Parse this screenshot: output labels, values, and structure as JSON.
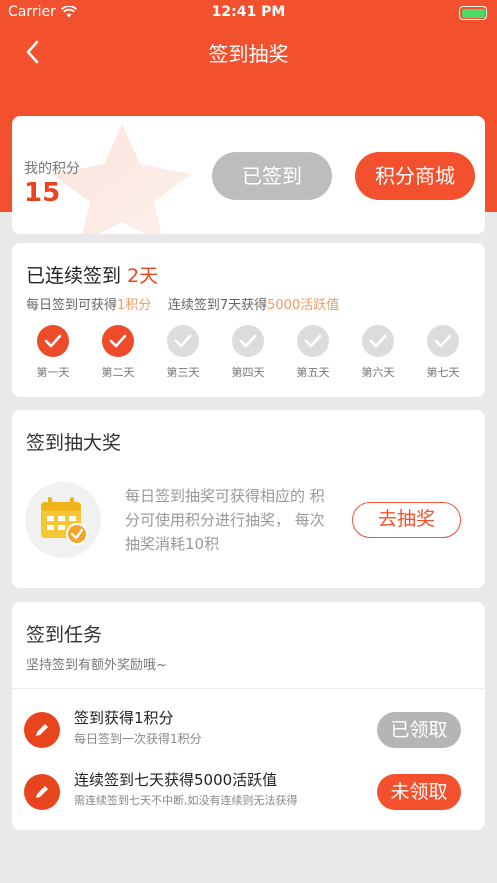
{
  "status_bar": {
    "carrier": "Carrier",
    "time": "12:41 PM"
  },
  "nav": {
    "title": "签到抽奖"
  },
  "points": {
    "label": "我的积分",
    "value": "15",
    "signed_button": "已签到",
    "mall_button": "积分商城"
  },
  "streak": {
    "title": "已连续签到",
    "days": "2天",
    "desc_prefix": "每日签到可获得",
    "desc_points": "1积分",
    "desc_middle": "连续签到7天获得",
    "desc_reward": "5000活跃值",
    "day_labels": [
      "第一天",
      "第二天",
      "第三天",
      "第四天",
      "第五天",
      "第六天",
      "第七天"
    ],
    "completed_days": 2
  },
  "lottery": {
    "title": "签到抽大奖",
    "description": "每日签到抽奖可获得相应的 积分可使用积分进行抽奖， 每次抽奖消耗10积",
    "draw_button": "去抽奖"
  },
  "tasks": {
    "title": "签到任务",
    "subtitle": "坚持签到有额外奖励哦~",
    "items": [
      {
        "name": "签到获得1积分",
        "desc": "每日签到一次获得1积分",
        "button": "已领取",
        "status": "claimed"
      },
      {
        "name": "连续签到七天获得5000活跃值",
        "desc": "需连续签到七天不中断,如没有连续则无法获得",
        "button": "未领取",
        "status": "unclaimed"
      }
    ]
  },
  "colors": {
    "brand": "#f3502d",
    "accent_text": "#e8441d",
    "highlight": "#f39a5c",
    "disabled": "#bdbdbd",
    "background": "#e9e9e9"
  }
}
